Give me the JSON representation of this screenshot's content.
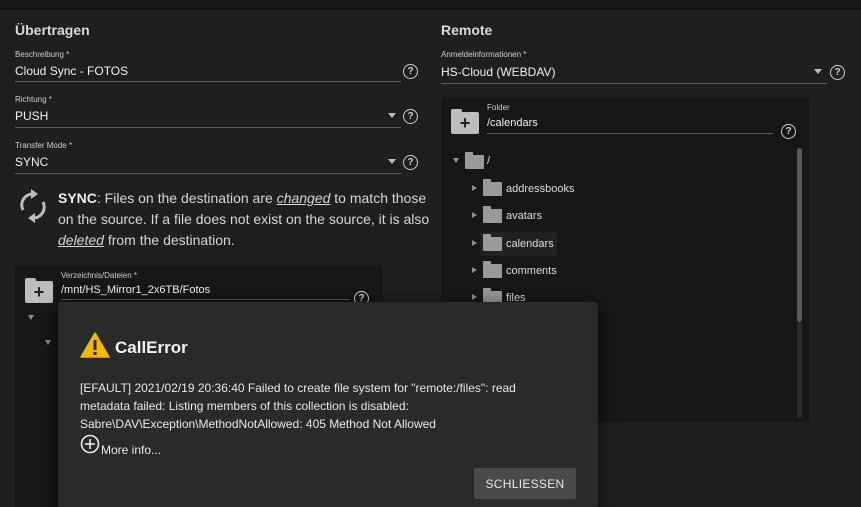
{
  "left": {
    "title": "Übertragen",
    "description_field": {
      "label": "Beschreibung *",
      "value": "Cloud Sync - FOTOS"
    },
    "direction_field": {
      "label": "Richtung *",
      "value": "PUSH"
    },
    "transfer_mode_field": {
      "label": "Transfer Mode *",
      "value": "SYNC"
    },
    "sync_info": {
      "bold": "SYNC",
      "part1": ": Files on the destination are ",
      "em1": "changed",
      "part2": " to match those on the source. If a file does not exist on the source, it is also ",
      "em2": "deleted",
      "part3": " from the destination."
    },
    "directory_field": {
      "label": "Verzeichnis/Dateien *",
      "value": "/mnt/HS_Mirror1_2x6TB/Fotos"
    }
  },
  "right": {
    "title": "Remote",
    "credentials_field": {
      "label": "Anmeldeinformationen *",
      "value": "HS-Cloud (WEBDAV)"
    },
    "folder_field": {
      "label": "Folder",
      "value": "/calendars"
    },
    "tree": {
      "root": "/",
      "items": [
        "addressbooks",
        "avatars",
        "calendars",
        "comments",
        "files"
      ]
    }
  },
  "dialog": {
    "title": "CallError",
    "message": "[EFAULT] 2021/02/19 20:36:40 Failed to create file system for \"remote:/files\": read metadata failed: Listing members of this collection is disabled: Sabre\\DAV\\Exception\\MethodNotAllowed: 405 Method Not Allowed",
    "more_info": "More info...",
    "close_button": "SCHLIESSEN"
  },
  "icons": {
    "help": "help-circle-icon",
    "sync": "sync-icon",
    "warning": "warning-icon",
    "folder": "folder-icon",
    "add_folder": "add-folder-icon",
    "expand": "plus-circle-icon"
  },
  "colors": {
    "background": "#1f1f1f",
    "dialog_bg": "#2a2a2a",
    "warning": "#f5b800",
    "button_bg": "#4a4a4a"
  }
}
